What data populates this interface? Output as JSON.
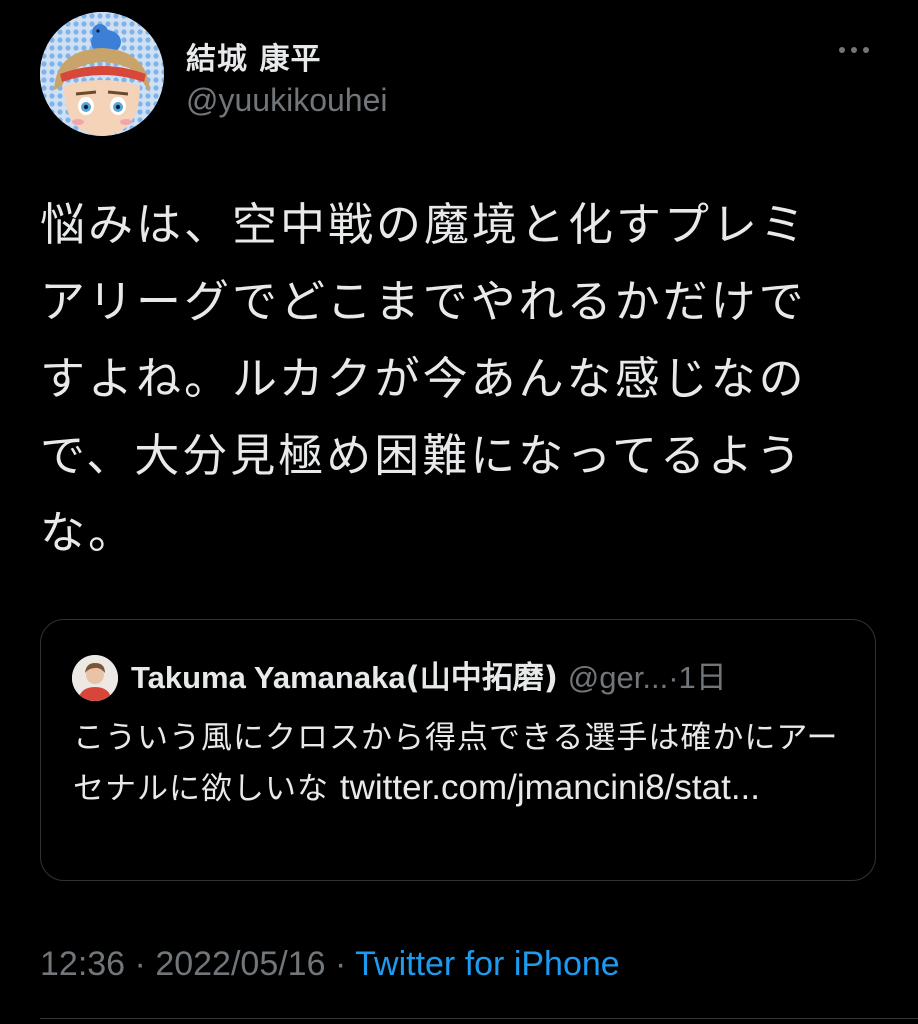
{
  "author": {
    "display_name": "結城 康平",
    "handle": "@yuukikouhei",
    "avatar_icon": "illustrated-avatar-icon"
  },
  "tweet": {
    "lines": [
      "悩みは、空中戦の魔境と化すプレミ",
      "アリーグでどこまでやれるかだけで",
      "すよね。ルカクが今あんな感じなの",
      "で、大分見極め困難になってるよう",
      "な。"
    ]
  },
  "quote": {
    "name": "Takuma Yamanaka",
    "name_jp": "(山中拓磨)",
    "handle": "@ger...",
    "dot": "·",
    "time": "1日",
    "text_prefix": "こういう風にクロスから得点できる選手は確かにアーセナルに欲しいな ",
    "link": "twitter.com/jmancini8/stat..."
  },
  "meta": {
    "time": "12:36",
    "sep1": "·",
    "date": "2022/05/16",
    "sep2": "·",
    "source": "Twitter for iPhone"
  },
  "colors": {
    "background": "#000000",
    "text": "#e7e9ea",
    "secondary": "#71767b",
    "link": "#1d9bf0",
    "border": "#2f3336"
  }
}
